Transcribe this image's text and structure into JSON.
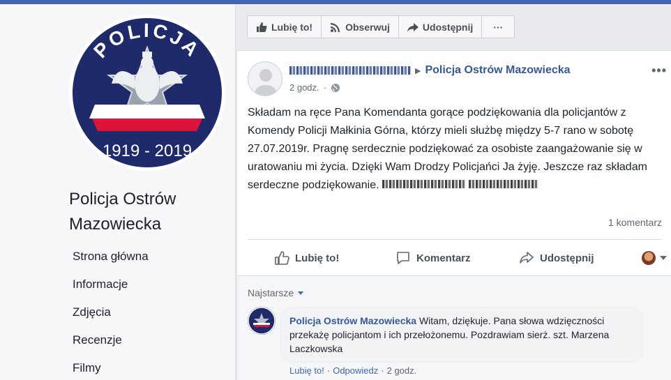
{
  "colors": {
    "brand": "#4267b2",
    "link": "#365899",
    "text": "#1d2129"
  },
  "page": {
    "name": "Policja Ostrów Mazowiecka",
    "logo": {
      "ring_text": "POLICJA",
      "years": "1919 - 2019"
    }
  },
  "sidebar": {
    "items": [
      {
        "label": "Strona główna"
      },
      {
        "label": "Informacje"
      },
      {
        "label": "Zdjęcia"
      },
      {
        "label": "Recenzje"
      },
      {
        "label": "Filmy"
      }
    ]
  },
  "toolbar": {
    "like_label": "Lubię to!",
    "follow_label": "Obserwuj",
    "share_label": "Udostępnij",
    "more_label": "···"
  },
  "post": {
    "target_page": "Policja Ostrów Mazowiecka",
    "time": "2 godz.",
    "privacy_icon": "globe-icon",
    "text": "Składam na ręce Pana Komendanta gorące podziękowania dla policjantów z Komendy Policji Małkinia Górna, którzy mieli służbę między 5-7 rano w sobotę 27.07.2019r. Pragnę serdecznie podziękować za osobiste zaangażowanie się w uratowaniu mi życia. Dzięki Wam Drodzy Policjańci Ja żyję. Jeszcze raz składam serdeczne podziękowanie.",
    "comment_count": "1 komentarz",
    "actions": {
      "like": "Lubię to!",
      "comment": "Komentarz",
      "share": "Udostępnij"
    }
  },
  "comments": {
    "sort_label": "Najstarsze",
    "items": [
      {
        "author": "Policja Ostrów Mazowiecka",
        "text": "Witam, dziękuje. Pana słowa wdzięczności przekażę policjantom i ich przełożonemu. Pozdrawiam sierż. szt. Marzena Laczkowska",
        "like": "Lubię to!",
        "reply": "Odpowiedz",
        "time": "2 godz."
      }
    ]
  }
}
